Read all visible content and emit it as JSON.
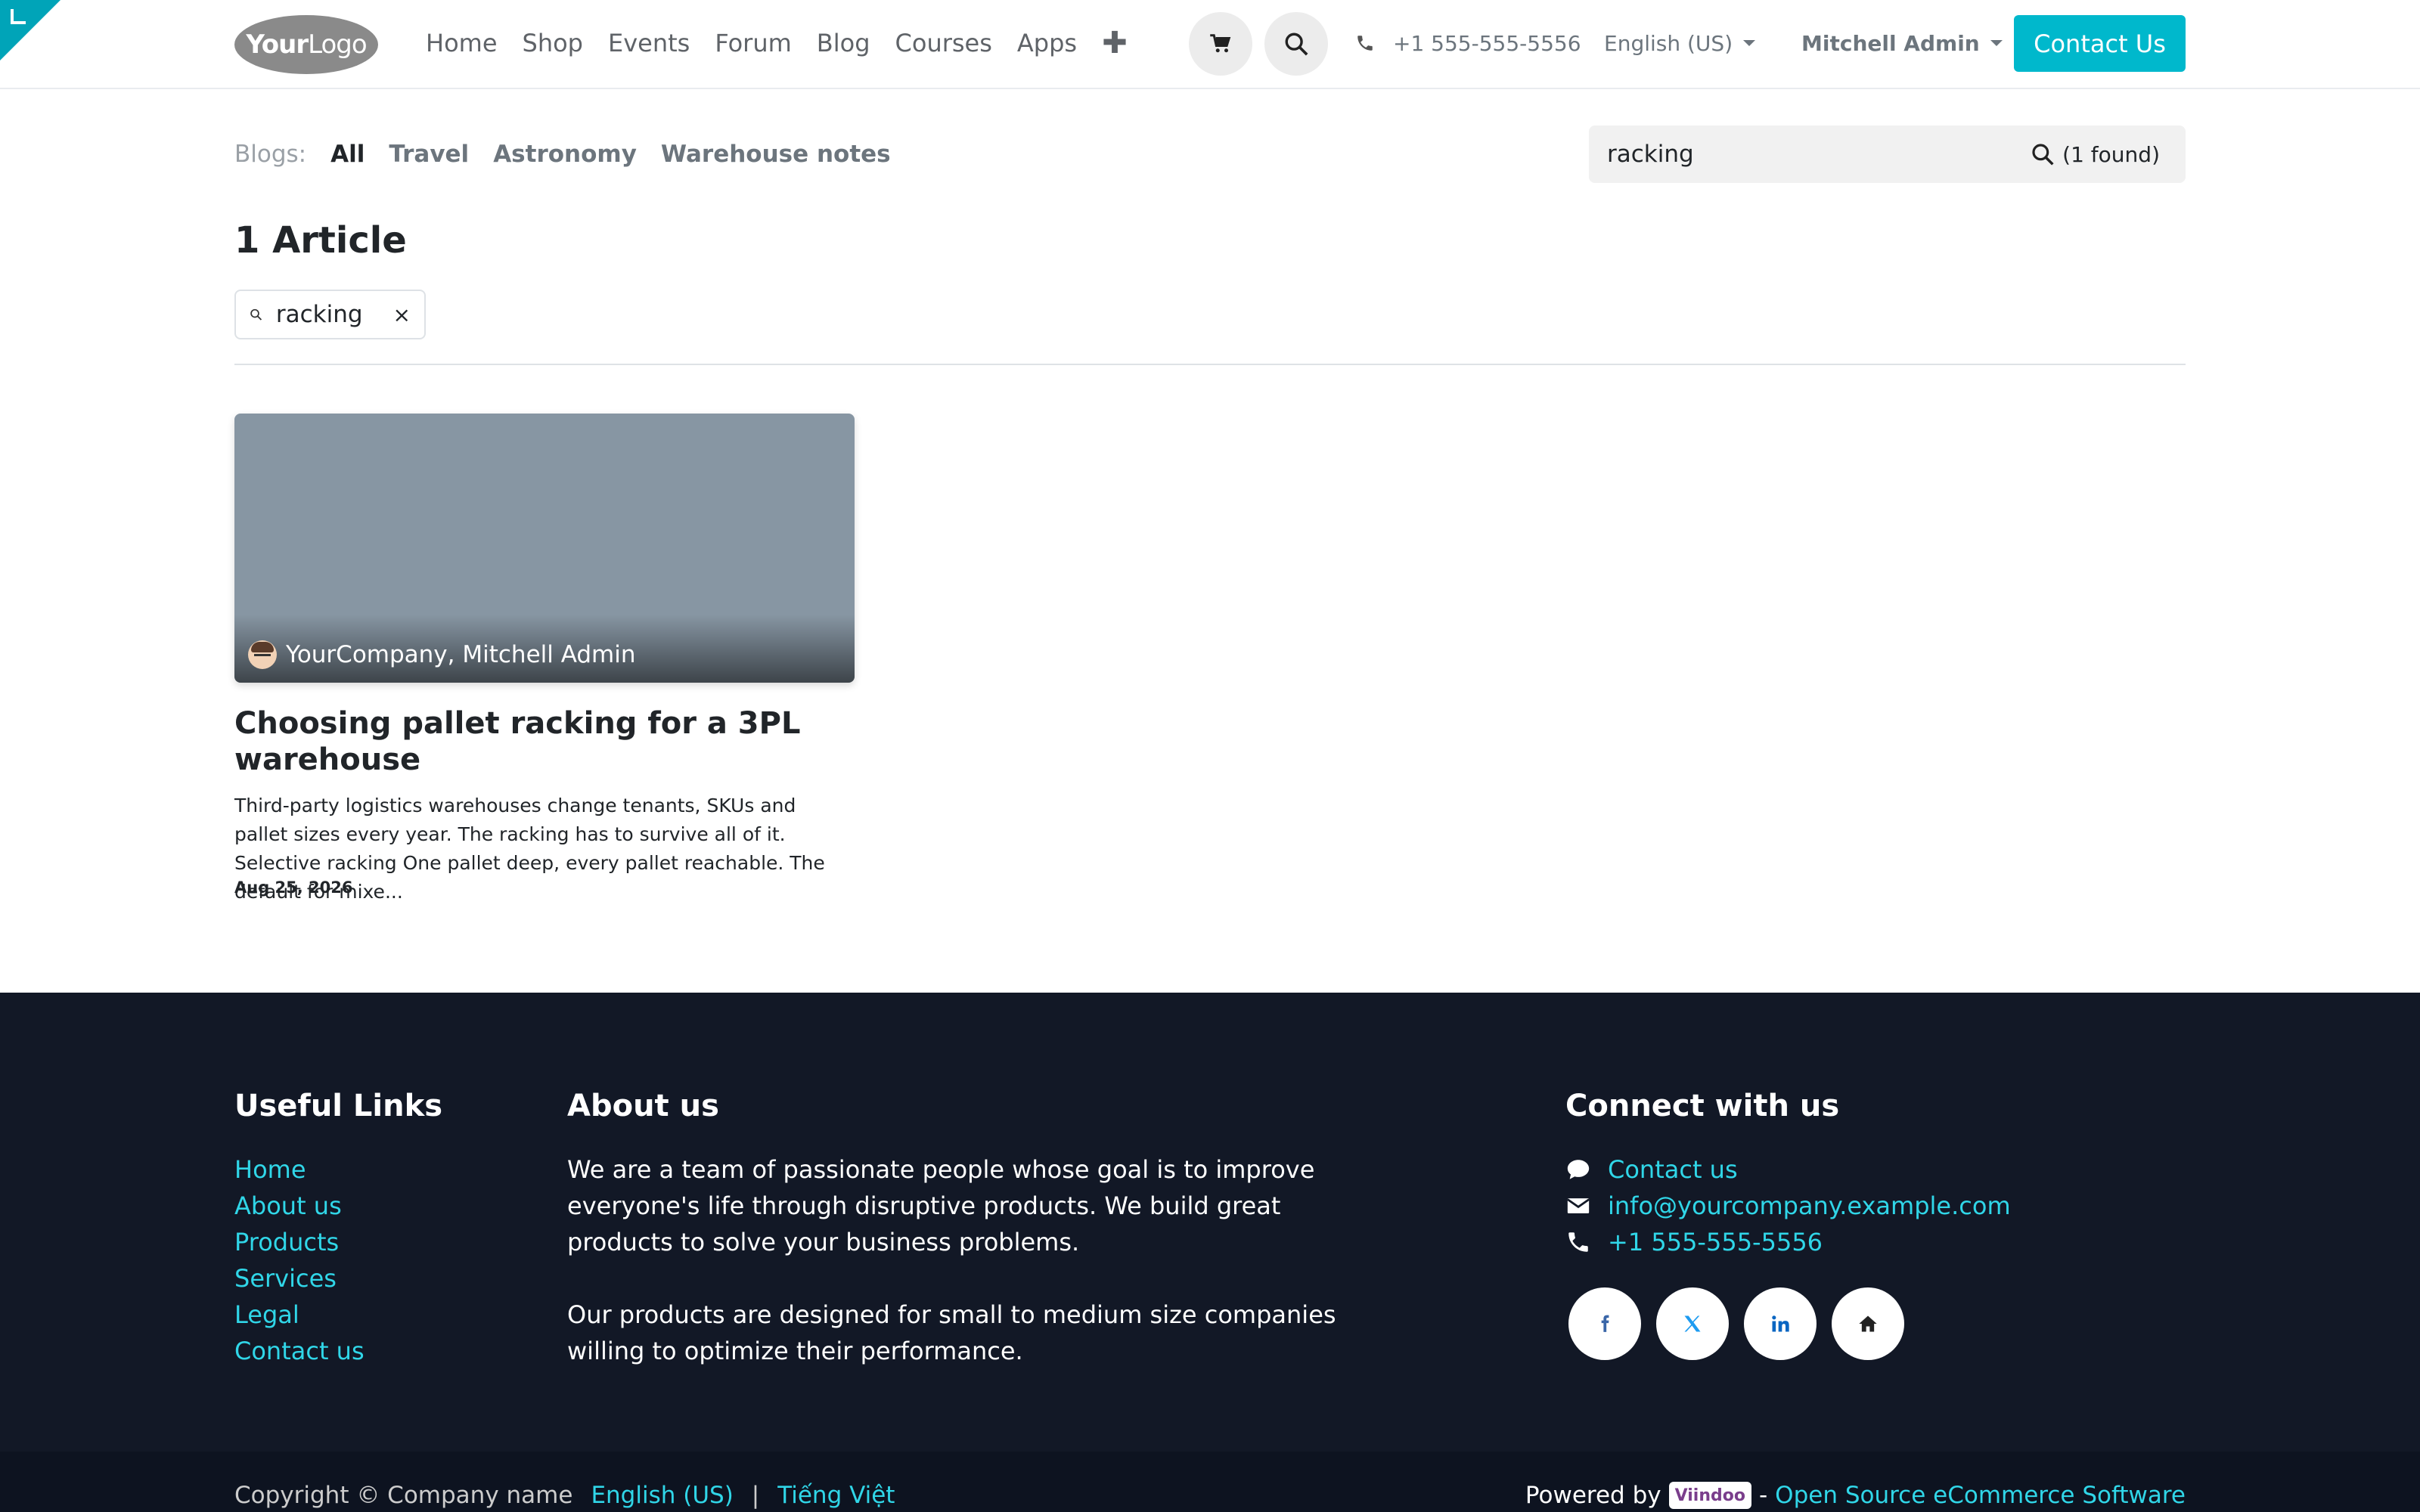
{
  "header": {
    "logo_bold": "Your",
    "logo_light": "Logo",
    "nav": [
      "Home",
      "Shop",
      "Events",
      "Forum",
      "Blog",
      "Courses",
      "Apps"
    ],
    "plus": "✚",
    "phone": "+1 555-555-5556",
    "language": "English (US)",
    "user": "Mitchell Admin",
    "contact_button": "Contact Us"
  },
  "blog_filter": {
    "label": "Blogs:",
    "tabs": [
      "All",
      "Travel",
      "Astronomy",
      "Warehouse notes"
    ],
    "active": "All",
    "search_value": "racking",
    "found": "(1 found)"
  },
  "results": {
    "count_title": "1 Article",
    "chip_value": "racking",
    "chip_close": "×"
  },
  "post": {
    "author": "YourCompany, Mitchell Admin",
    "title": "Choosing pallet racking for a 3PL warehouse",
    "excerpt": "Third-party logistics warehouses change tenants, SKUs and pallet sizes every year. The racking has to survive all of it. Selective racking One pallet deep, every pallet reachable. The default for mixe...",
    "date": "Aug 25, 2026",
    "image_color": "#8796a3"
  },
  "footer": {
    "useful_links_title": "Useful Links",
    "useful_links": [
      "Home",
      "About us",
      "Products",
      "Services",
      "Legal",
      "Contact us"
    ],
    "about_title": "About us",
    "about_p1": "We are a team of passionate people whose goal is to improve everyone's life through disruptive products. We build great products to solve your business problems.",
    "about_p2": "Our products are designed for small to medium size companies willing to optimize their performance.",
    "connect_title": "Connect with us",
    "contact_us": "Contact us",
    "email": "info@yourcompany.example.com",
    "phone": "+1 555-555-5556",
    "copyright": "Copyright © Company name",
    "lang_en": "English (US)",
    "separator": "|",
    "lang_vi": "Tiếng Việt",
    "powered_by": "Powered by",
    "powered_brand": "Viindoo",
    "powered_dash": "-",
    "powered_link": "Open Source eCommerce Software"
  },
  "colors": {
    "accent": "#00b8cc",
    "footer_bg": "#121826",
    "link": "#30d6e8"
  }
}
